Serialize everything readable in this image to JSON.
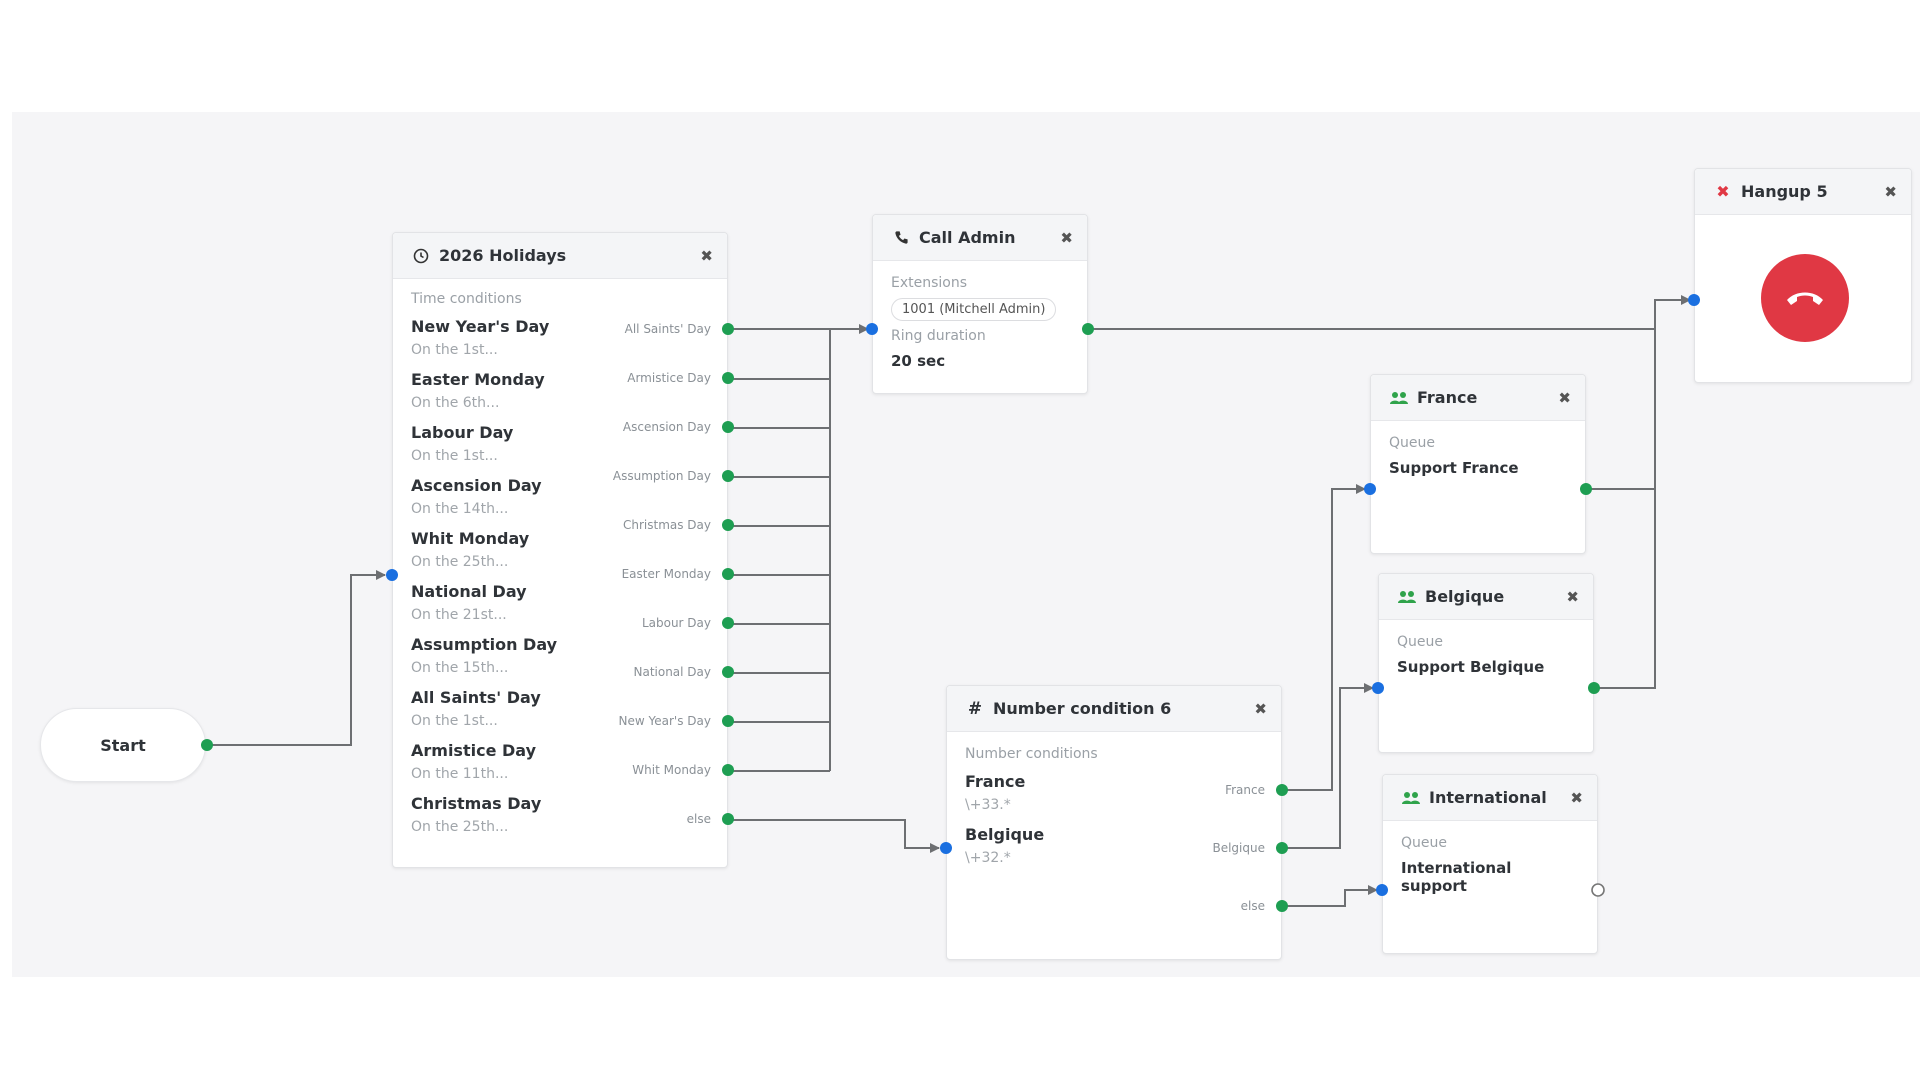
{
  "start": {
    "label": "Start"
  },
  "holidays": {
    "title": "2026 Holidays",
    "section_label": "Time conditions",
    "conditions": [
      {
        "name": "New Year's Day",
        "desc": "On the 1st..."
      },
      {
        "name": "Easter Monday",
        "desc": "On the 6th..."
      },
      {
        "name": "Labour Day",
        "desc": "On the 1st..."
      },
      {
        "name": "Ascension Day",
        "desc": "On the 14th..."
      },
      {
        "name": "Whit Monday",
        "desc": "On the 25th..."
      },
      {
        "name": "National Day",
        "desc": "On the 21st..."
      },
      {
        "name": "Assumption Day",
        "desc": "On the 15th..."
      },
      {
        "name": "All Saints' Day",
        "desc": "On the 1st..."
      },
      {
        "name": "Armistice Day",
        "desc": "On the 11th..."
      },
      {
        "name": "Christmas Day",
        "desc": "On the 25th..."
      }
    ],
    "ports": [
      "All Saints' Day",
      "Armistice Day",
      "Ascension Day",
      "Assumption Day",
      "Christmas Day",
      "Easter Monday",
      "Labour Day",
      "National Day",
      "New Year's Day",
      "Whit Monday",
      "else"
    ]
  },
  "call_admin": {
    "title": "Call Admin",
    "extensions_label": "Extensions",
    "extension": "1001 (Mitchell Admin)",
    "ring_label": "Ring duration",
    "ring_value": "20 sec"
  },
  "hangup": {
    "title": "Hangup 5"
  },
  "france": {
    "title": "France",
    "label": "Queue",
    "value": "Support France"
  },
  "belgique": {
    "title": "Belgique",
    "label": "Queue",
    "value": "Support Belgique"
  },
  "international": {
    "title": "International",
    "label": "Queue",
    "value": "International support"
  },
  "number_condition": {
    "title": "Number condition 6",
    "section_label": "Number conditions",
    "conditions": [
      {
        "name": "France",
        "pattern": "\\+33.*"
      },
      {
        "name": "Belgique",
        "pattern": "\\+32.*"
      }
    ],
    "ports": [
      "France",
      "Belgique",
      "else"
    ]
  },
  "colors": {
    "output_port": "#1e9e52",
    "input_port": "#1a6fe0",
    "wire": "#6d6f72",
    "hangup": "#e03844",
    "queue_icon": "#2fa34b"
  }
}
